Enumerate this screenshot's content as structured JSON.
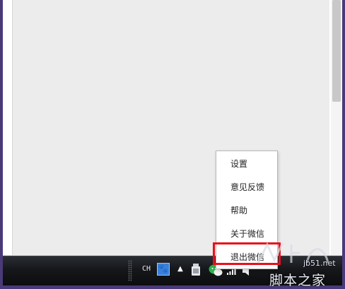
{
  "context_menu": {
    "items": [
      {
        "label": "设置"
      },
      {
        "label": "意见反馈"
      },
      {
        "label": "帮助"
      },
      {
        "label": "关于微信"
      },
      {
        "label": "退出微信",
        "highlighted": true
      }
    ]
  },
  "taskbar": {
    "language": "CH",
    "ime_icon": "paw-icon",
    "tray_icons": [
      "show-hidden-icons-arrow",
      "device-icon",
      "wechat-icon",
      "network-signal-icon",
      "volume-icon"
    ]
  },
  "watermark": {
    "site": "jb51.net",
    "name": "脚本之家"
  },
  "colors": {
    "highlight": "#e8101c",
    "frame": "#4a3a78",
    "taskbar": "#15171a"
  }
}
